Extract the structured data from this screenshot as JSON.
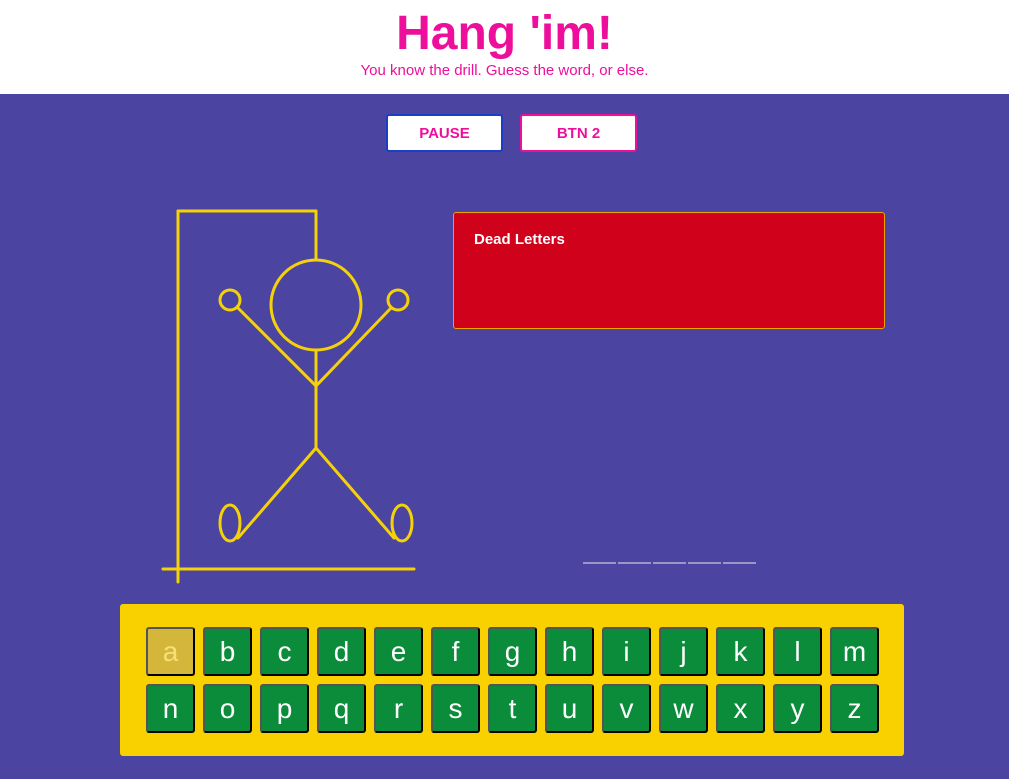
{
  "header": {
    "title": "Hang 'im!",
    "subtitle": "You know the drill. Guess the word, or else."
  },
  "controls": {
    "pause_label": "PAUSE",
    "btn2_label": "BTN 2"
  },
  "dead_letters": {
    "title": "Dead Letters",
    "letters": []
  },
  "word": {
    "length": 5,
    "revealed": [
      "",
      "",
      "",
      "",
      ""
    ]
  },
  "keyboard": {
    "keys": [
      {
        "letter": "a",
        "used": true
      },
      {
        "letter": "b",
        "used": false
      },
      {
        "letter": "c",
        "used": false
      },
      {
        "letter": "d",
        "used": false
      },
      {
        "letter": "e",
        "used": false
      },
      {
        "letter": "f",
        "used": false
      },
      {
        "letter": "g",
        "used": false
      },
      {
        "letter": "h",
        "used": false
      },
      {
        "letter": "i",
        "used": false
      },
      {
        "letter": "j",
        "used": false
      },
      {
        "letter": "k",
        "used": false
      },
      {
        "letter": "l",
        "used": false
      },
      {
        "letter": "m",
        "used": false
      },
      {
        "letter": "n",
        "used": false
      },
      {
        "letter": "o",
        "used": false
      },
      {
        "letter": "p",
        "used": false
      },
      {
        "letter": "q",
        "used": false
      },
      {
        "letter": "r",
        "used": false
      },
      {
        "letter": "s",
        "used": false
      },
      {
        "letter": "t",
        "used": false
      },
      {
        "letter": "u",
        "used": false
      },
      {
        "letter": "v",
        "used": false
      },
      {
        "letter": "w",
        "used": false
      },
      {
        "letter": "x",
        "used": false
      },
      {
        "letter": "y",
        "used": false
      },
      {
        "letter": "z",
        "used": false
      }
    ]
  },
  "colors": {
    "brand_pink": "#ee0e9c",
    "background": "#4b44a0",
    "gallows": "#f5d10a",
    "dead_panel": "#d0021b",
    "key_active": "#0a8c3a",
    "key_used": "#d4b63a",
    "keyboard_bg": "#f9d100"
  }
}
